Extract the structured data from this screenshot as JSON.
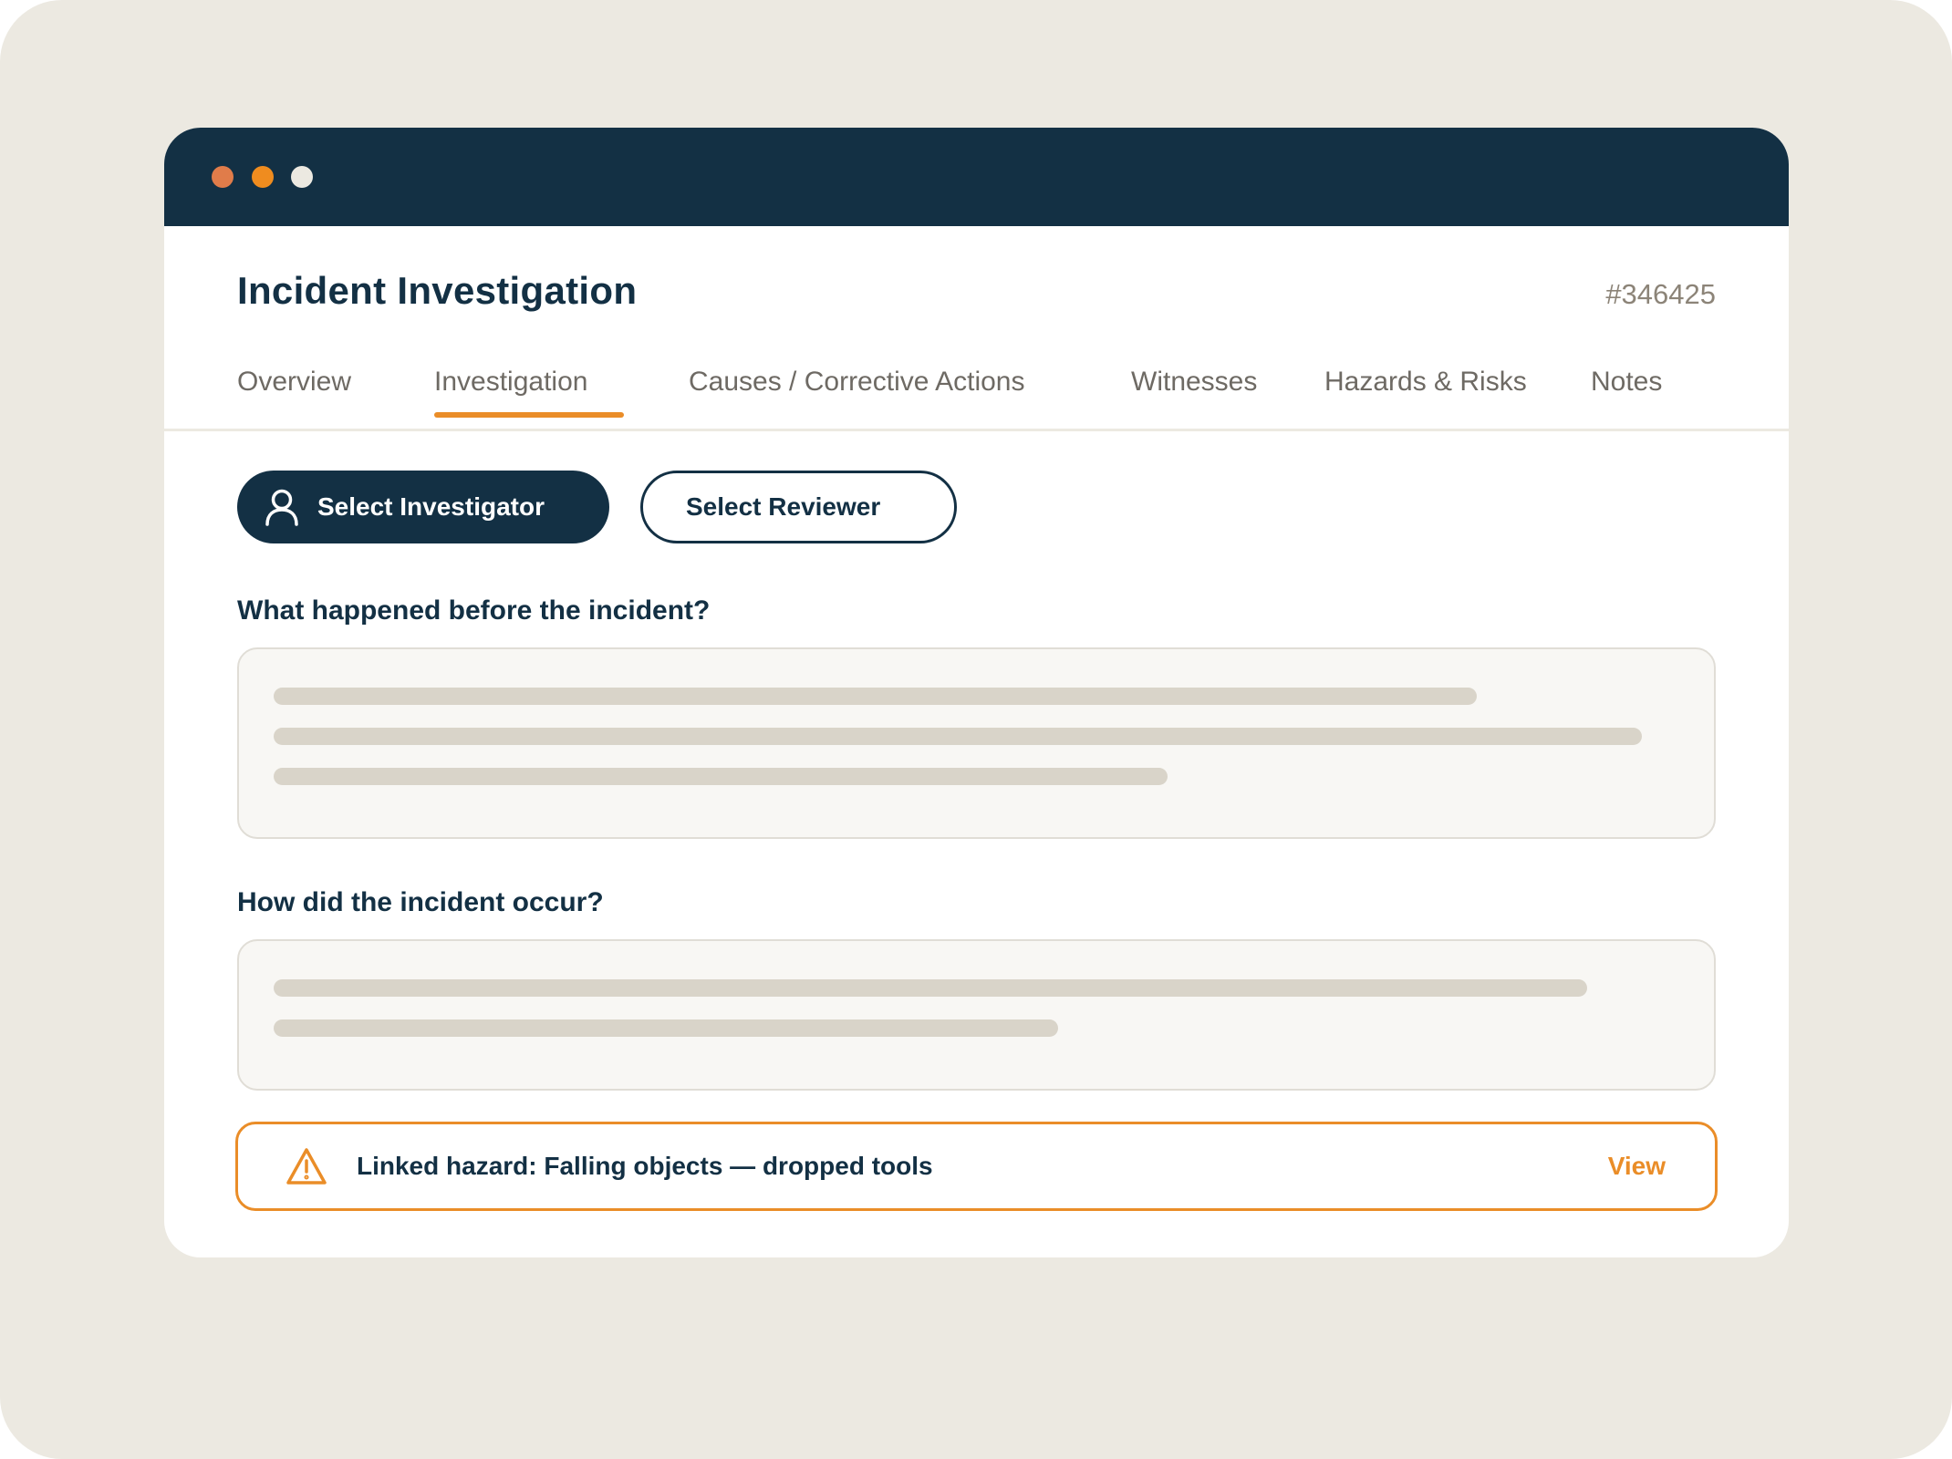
{
  "window": {
    "controls": [
      {
        "name": "close",
        "color": "#e07c4a"
      },
      {
        "name": "minimize",
        "color": "#ef8c1f"
      },
      {
        "name": "maximize",
        "color": "#ece9e1"
      }
    ]
  },
  "header": {
    "title": "Incident Investigation",
    "record_id": "#346425"
  },
  "tabs": [
    {
      "label": "Overview",
      "active": false
    },
    {
      "label": "Investigation",
      "active": true
    },
    {
      "label": "Causes / Corrective Actions",
      "active": false
    },
    {
      "label": "Witnesses",
      "active": false
    },
    {
      "label": "Hazards & Risks",
      "active": false
    },
    {
      "label": "Notes",
      "active": false
    }
  ],
  "actions": {
    "select_investigator": {
      "label": "Select Investigator",
      "icon": "user-icon"
    },
    "select_reviewer": {
      "label": "Select Reviewer"
    }
  },
  "questions": [
    {
      "label": "What happened before the incident?",
      "placeholder_lines": 3
    },
    {
      "label": "How did the incident occur?",
      "placeholder_lines": 2
    }
  ],
  "linked_hazard": {
    "icon": "warning-icon",
    "text": "Linked hazard: Falling objects — dropped tools",
    "action_label": "View"
  },
  "colors": {
    "navy": "#133044",
    "accent": "#ea8d28",
    "background": "#ece9e1",
    "placeholder": "#d9d4c9"
  }
}
